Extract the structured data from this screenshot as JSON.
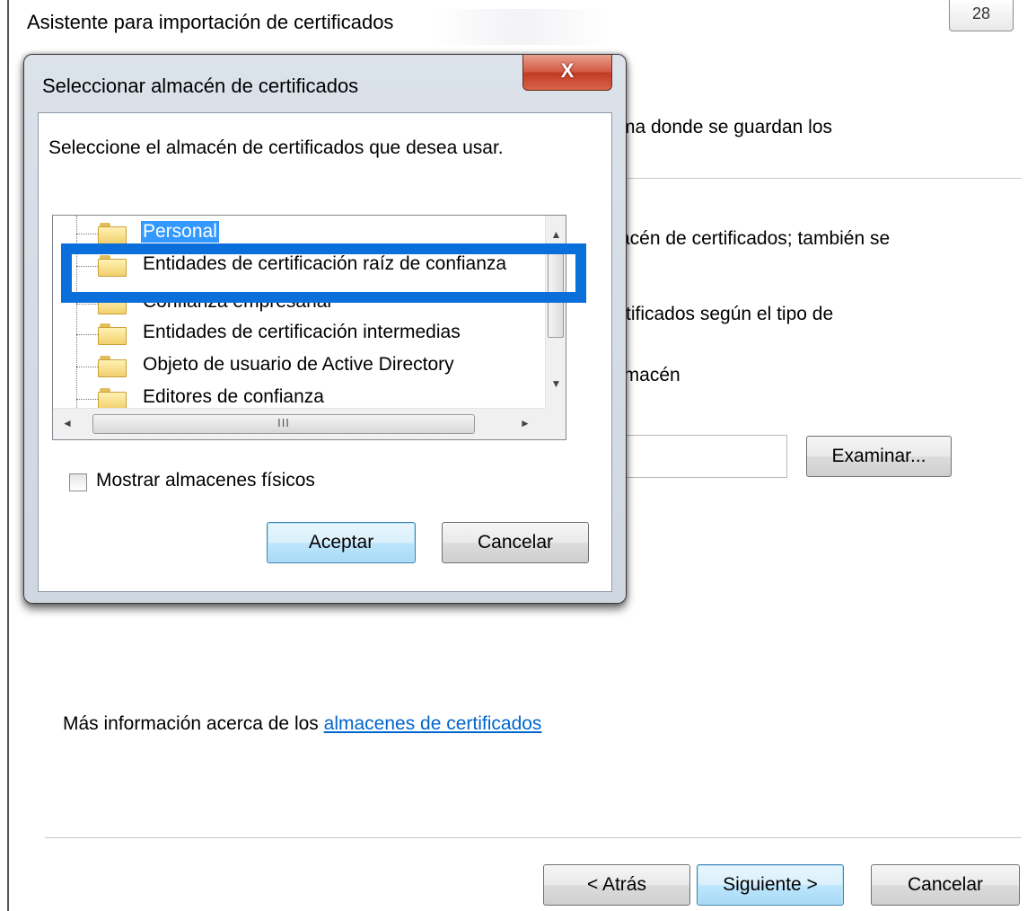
{
  "wizard": {
    "title": "Asistente para importación de certificados",
    "top_button": "28",
    "text_lines": [
      "ma donde se guardan los",
      "acén de certificados; también se",
      "rtificados según el tipo de",
      "lmacén"
    ],
    "browse_button": "Examinar...",
    "info_prefix": "Más información acerca de los ",
    "info_link": "almacenes de certificados",
    "back_button": "< Atrás",
    "next_button": "Siguiente >",
    "cancel_button": "Cancelar"
  },
  "dialog": {
    "title": "Seleccionar almacén de certificados",
    "close_glyph": "X",
    "prompt": "Seleccione el almacén de certificados que desea usar.",
    "tree_items": [
      "Personal",
      "Entidades de certificación raíz de confianza",
      "Confianza empresarial",
      "Entidades de certificación intermedias",
      "Objeto de usuario de Active Directory",
      "Editores de confianza"
    ],
    "selected_index": 0,
    "scroll_up": "▲",
    "scroll_down": "▼",
    "scroll_left": "◄",
    "scroll_right": "►",
    "scroll_grip": "III",
    "show_physical_label": "Mostrar almacenes físicos",
    "show_physical_checked": false,
    "ok_button": "Aceptar",
    "cancel_button": "Cancelar"
  },
  "colors": {
    "selection": "#3399ff",
    "highlight_box": "#0a6edb",
    "link": "#0066cc",
    "close_button": "#c13a24"
  }
}
